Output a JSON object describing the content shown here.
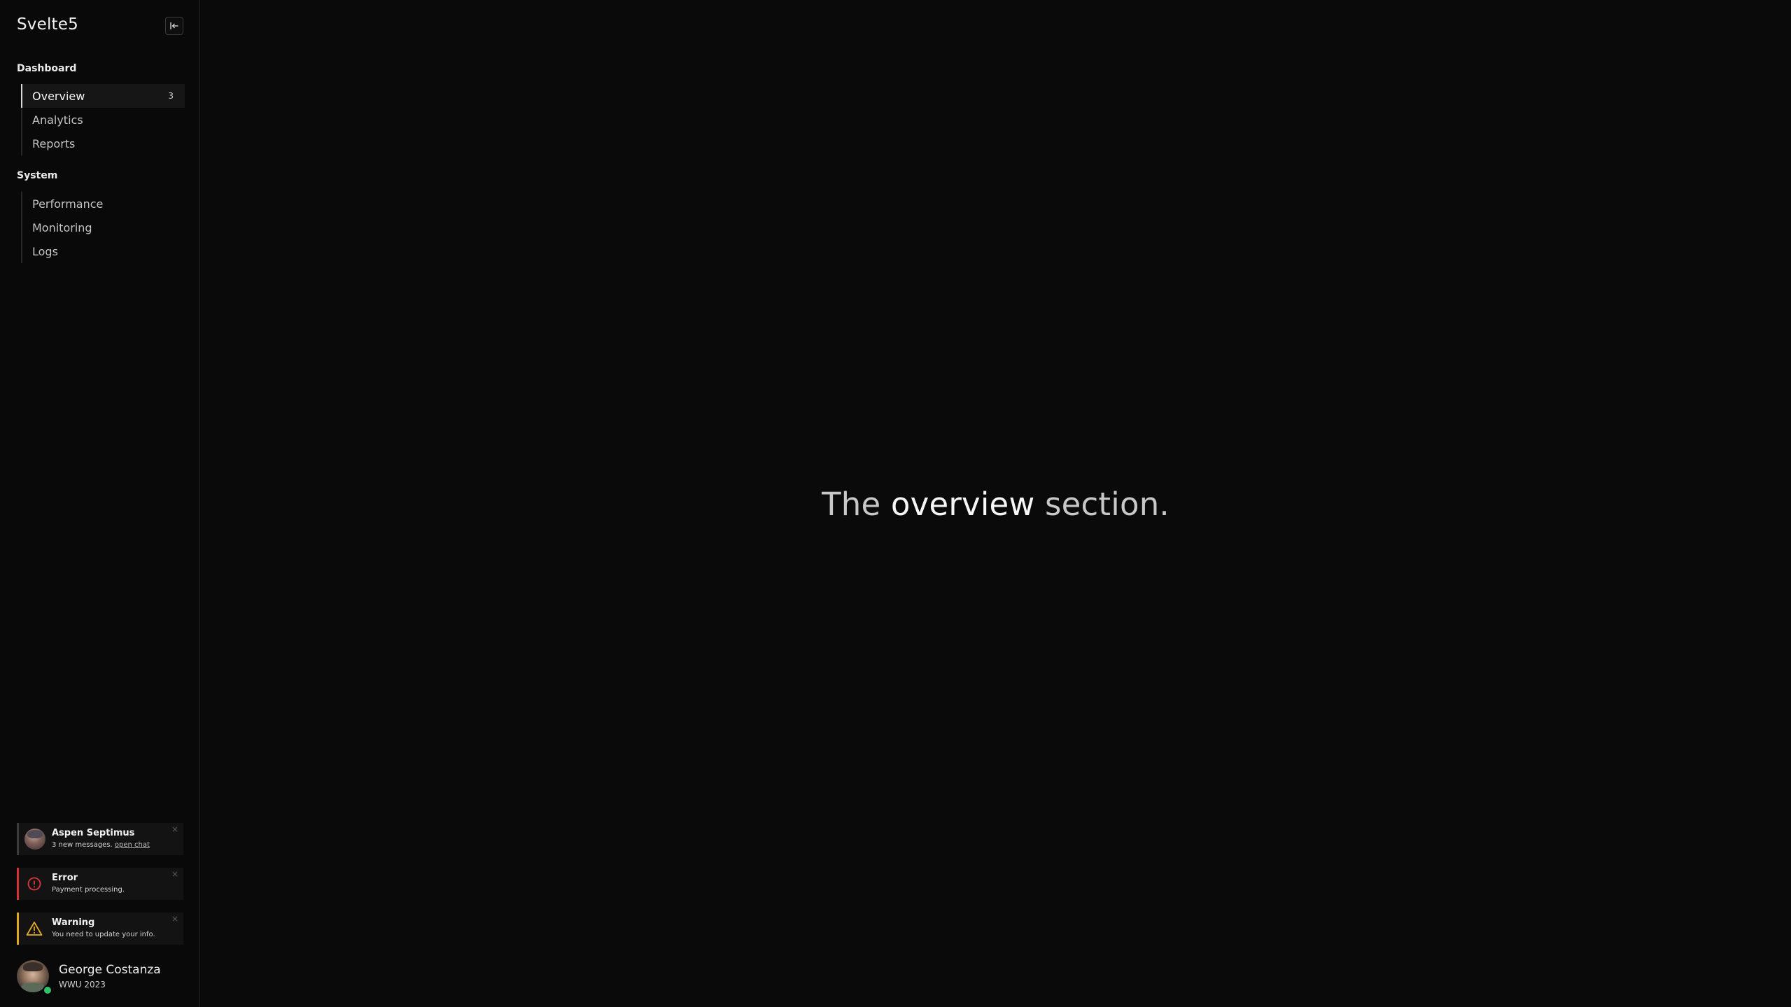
{
  "sidebar": {
    "brand": "Svelte5",
    "sections": [
      {
        "title": "Dashboard",
        "items": [
          {
            "label": "Overview",
            "badge": "3",
            "active": true
          },
          {
            "label": "Analytics"
          },
          {
            "label": "Reports"
          }
        ]
      },
      {
        "title": "System",
        "items": [
          {
            "label": "Performance"
          },
          {
            "label": "Monitoring"
          },
          {
            "label": "Logs"
          }
        ]
      }
    ]
  },
  "notifications": [
    {
      "type": "message",
      "title": "Aspen Septimus",
      "text": "3 new messages.",
      "link": "open chat",
      "close": "×"
    },
    {
      "type": "error",
      "title": "Error",
      "text": "Payment processing.",
      "close": "×",
      "color": "#dc2f3a"
    },
    {
      "type": "warning",
      "title": "Warning",
      "text": "You need to update your info.",
      "close": "×",
      "color": "#e0a91c"
    }
  ],
  "user": {
    "name": "George Costanza",
    "subtitle": "WWU 2023",
    "status_color": "#2fc26b"
  },
  "main": {
    "headline_pre": "The ",
    "headline_em": "overview",
    "headline_post": " section."
  },
  "icons": {
    "collapse": "collapse-sidebar-icon",
    "error": "alert-circle-icon",
    "warning": "warning-triangle-icon"
  }
}
